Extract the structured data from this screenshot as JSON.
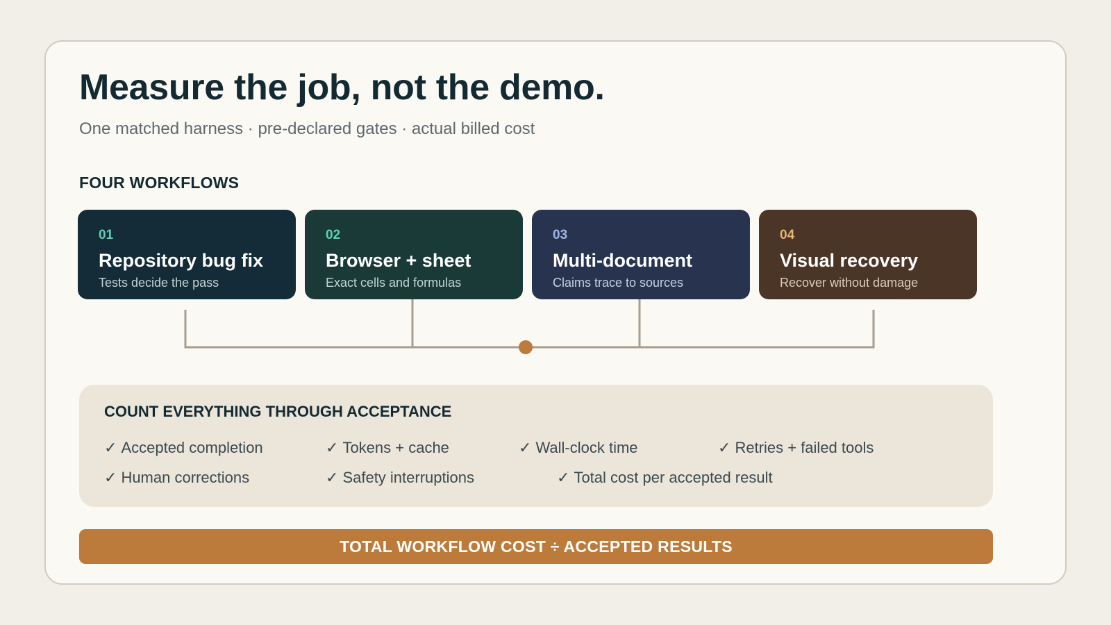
{
  "title": "Measure the job, not the demo.",
  "subtitle": "One matched harness · pre-declared gates · actual billed cost",
  "workflows": {
    "label": "FOUR WORKFLOWS",
    "items": [
      {
        "num": "01",
        "title": "Repository bug fix",
        "desc": "Tests decide the pass",
        "bg": "#132c38",
        "num_color": "#5fd0b6",
        "desc_color": "#c3d2d6"
      },
      {
        "num": "02",
        "title": "Browser + sheet",
        "desc": "Exact cells and formulas",
        "bg": "#1a3a38",
        "num_color": "#5fd0b6",
        "desc_color": "#c3d6d2"
      },
      {
        "num": "03",
        "title": "Multi-document",
        "desc": "Claims trace to sources",
        "bg": "#28344f",
        "num_color": "#9fb6e6",
        "desc_color": "#c7cfe0"
      },
      {
        "num": "04",
        "title": "Visual recovery",
        "desc": "Recover without damage",
        "bg": "#4a3526",
        "num_color": "#e6b577",
        "desc_color": "#dccbbb"
      }
    ]
  },
  "colors": {
    "connector": "#a79d91",
    "hub": "#bd7b3b",
    "accent": "#bd7b3b"
  },
  "metrics": {
    "heading": "COUNT EVERYTHING THROUGH ACCEPTANCE",
    "check": "✓",
    "items": [
      "Accepted completion",
      "Tokens + cache",
      "Wall-clock time",
      "Retries + failed tools",
      "Human corrections",
      "Safety interruptions",
      "Total cost per accepted result"
    ]
  },
  "formula": "TOTAL WORKFLOW COST ÷ ACCEPTED RESULTS"
}
